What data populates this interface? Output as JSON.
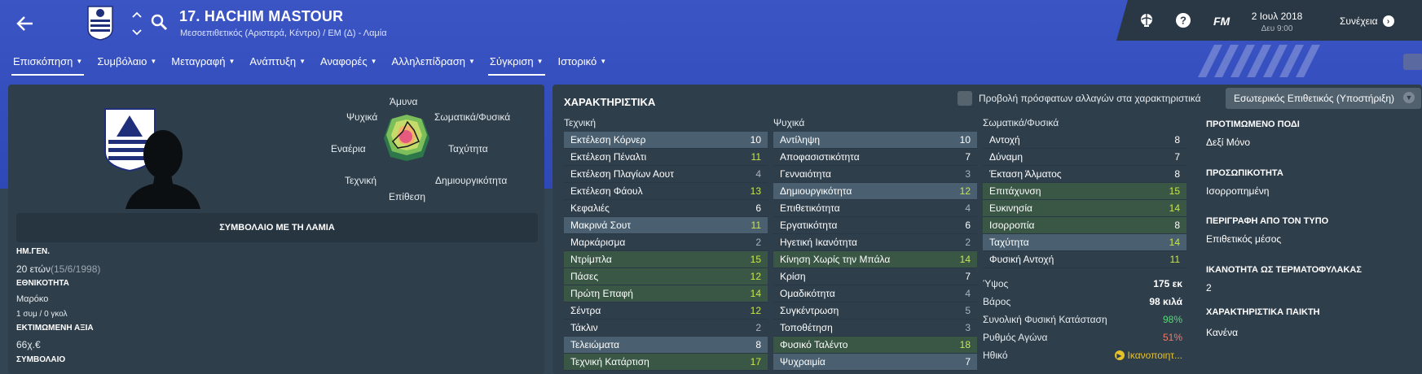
{
  "header": {
    "player_name": "17. HACHIM MASTOUR",
    "player_sub": "Μεσοεπιθετικός (Αριστερά, Κέντρο) / ΕΜ (Δ) - Λαμία"
  },
  "topbar": {
    "fm_label": "FM",
    "date": "2 Ιουλ 2018",
    "time": "Δευ 9:00",
    "continue_label": "Συνέχεια"
  },
  "nav": {
    "tabs": [
      "Επισκόπηση",
      "Συμβόλαιο",
      "Μεταγραφή",
      "Ανάπτυξη",
      "Αναφορές",
      "Αλληλεπίδραση",
      "Σύγκριση",
      "Ιστορικό"
    ]
  },
  "left": {
    "contract_bar": "ΣΥΜΒΟΛΑΙΟ ΜΕ ΤΗ ΛΑΜΙΑ",
    "dob_h": "ΗΜ.ΓΕΝ.",
    "dob_age": "20 ετών",
    "dob_date": "(15/6/1998)",
    "nat_h": "ΕΘΝΙΚΟΤΗΤΑ",
    "nat_v": "Μαρόκο",
    "caps": "1 συμ / 0 γκολ",
    "value_h": "ΕΚΤΙΜΩΜΕΝΗ ΑΞΙΑ",
    "value_v": "66χ.€",
    "contract_h": "ΣΥΜΒΟΛΑΙΟ"
  },
  "radar": {
    "labels": [
      "Άμυνα",
      "Σωματικά/Φυσικά",
      "Ταχύτητα",
      "Δημιουργικότητα",
      "Επίθεση",
      "Τεχνική",
      "Εναέρια",
      "Ψυχικά"
    ]
  },
  "attributes": {
    "title": "ΧΑΡΑΚΤΗΡΙΣΤΙΚΑ",
    "recent_changes": "Προβολή πρόσφατων αλλαγών στα χαρακτηριστικά",
    "role": "Εσωτερικός Επιθετικός (Υποστήριξη)",
    "technical_h": "Τεχνική",
    "mental_h": "Ψυχικά",
    "physical_h": "Σωματικά/Φυσικά",
    "technical": [
      {
        "name": "Εκτέλεση Κόρνερ",
        "value": "10",
        "style": "b",
        "vc": "w"
      },
      {
        "name": "Εκτέλεση Πέναλτι",
        "value": "11",
        "style": "n",
        "vc": "y"
      },
      {
        "name": "Εκτέλεση Πλαγίων Αουτ",
        "value": "4",
        "style": "n",
        "vc": ""
      },
      {
        "name": "Εκτέλεση Φάουλ",
        "value": "13",
        "style": "n",
        "vc": "y"
      },
      {
        "name": "Κεφαλιές",
        "value": "6",
        "style": "n",
        "vc": "w"
      },
      {
        "name": "Μακρινά Σουτ",
        "value": "11",
        "style": "b",
        "vc": "y"
      },
      {
        "name": "Μαρκάρισμα",
        "value": "2",
        "style": "n",
        "vc": ""
      },
      {
        "name": "Ντρίμπλα",
        "value": "15",
        "style": "g",
        "vc": "y"
      },
      {
        "name": "Πάσες",
        "value": "12",
        "style": "g",
        "vc": "y"
      },
      {
        "name": "Πρώτη Επαφή",
        "value": "14",
        "style": "g",
        "vc": "y"
      },
      {
        "name": "Σέντρα",
        "value": "12",
        "style": "n",
        "vc": "y"
      },
      {
        "name": "Τάκλιν",
        "value": "2",
        "style": "n",
        "vc": ""
      },
      {
        "name": "Τελειώματα",
        "value": "8",
        "style": "b",
        "vc": "w"
      },
      {
        "name": "Τεχνική Κατάρτιση",
        "value": "17",
        "style": "g",
        "vc": "y"
      }
    ],
    "mental": [
      {
        "name": "Αντίληψη",
        "value": "10",
        "style": "b",
        "vc": "w"
      },
      {
        "name": "Αποφασιστικότητα",
        "value": "7",
        "style": "n",
        "vc": "w"
      },
      {
        "name": "Γενναιότητα",
        "value": "3",
        "style": "n",
        "vc": ""
      },
      {
        "name": "Δημιουργικότητα",
        "value": "12",
        "style": "b",
        "vc": "y"
      },
      {
        "name": "Επιθετικότητα",
        "value": "4",
        "style": "n",
        "vc": ""
      },
      {
        "name": "Εργατικότητα",
        "value": "6",
        "style": "n",
        "vc": "w"
      },
      {
        "name": "Ηγετική Ικανότητα",
        "value": "2",
        "style": "n",
        "vc": ""
      },
      {
        "name": "Κίνηση Χωρίς την Μπάλα",
        "value": "14",
        "style": "g",
        "vc": "y"
      },
      {
        "name": "Κρίση",
        "value": "7",
        "style": "n",
        "vc": "w"
      },
      {
        "name": "Ομαδικότητα",
        "value": "4",
        "style": "n",
        "vc": ""
      },
      {
        "name": "Συγκέντρωση",
        "value": "5",
        "style": "n",
        "vc": ""
      },
      {
        "name": "Τοποθέτηση",
        "value": "3",
        "style": "n",
        "vc": ""
      },
      {
        "name": "Φυσικό Ταλέντο",
        "value": "18",
        "style": "g",
        "vc": "y"
      },
      {
        "name": "Ψυχραιμία",
        "value": "7",
        "style": "b",
        "vc": "w"
      }
    ],
    "physical": [
      {
        "name": "Αντοχή",
        "value": "8",
        "style": "n",
        "vc": "w"
      },
      {
        "name": "Δύναμη",
        "value": "7",
        "style": "n",
        "vc": "w"
      },
      {
        "name": "Έκταση Άλματος",
        "value": "8",
        "style": "n",
        "vc": "w"
      },
      {
        "name": "Επιτάχυνση",
        "value": "15",
        "style": "g",
        "vc": "y"
      },
      {
        "name": "Ευκινησία",
        "value": "14",
        "style": "g",
        "vc": "y"
      },
      {
        "name": "Ισορροπία",
        "value": "8",
        "style": "g",
        "vc": "w"
      },
      {
        "name": "Ταχύτητα",
        "value": "14",
        "style": "b",
        "vc": "y"
      },
      {
        "name": "Φυσική Αντοχή",
        "value": "11",
        "style": "n",
        "vc": "y"
      }
    ],
    "phys_info": [
      {
        "label": "Ύψος",
        "value": "175 εκ",
        "cls": ""
      },
      {
        "label": "Βάρος",
        "value": "98 κιλά",
        "cls": ""
      },
      {
        "label": "Συνολική Φυσική Κατάσταση",
        "value": "98%",
        "cls": "green"
      },
      {
        "label": "Ρυθμός Αγώνα",
        "value": "51%",
        "cls": "red"
      },
      {
        "label": "Ηθικό",
        "value": "Ικανοποιητ...",
        "cls": "pos"
      }
    ]
  },
  "right_info": {
    "foot_h": "ΠΡΟΤΙΜΩΜΕΝΟ ΠΟΔΙ",
    "foot_v": "Δεξί Μόνο",
    "pers_h": "ΠΡΟΣΩΠΙΚΟΤΗΤΑ",
    "pers_v": "Ισορροπημένη",
    "media_h": "ΠΕΡΙΓΡΑΦΗ ΑΠΟ ΤΟΝ ΤΥΠΟ",
    "media_v": "Επιθετικός μέσος",
    "gk_h": "ΙΚΑΝΟΤΗΤΑ ΩΣ ΤΕΡΜΑΤΟΦΥΛΑΚΑΣ",
    "gk_v": "2",
    "traits_h": "ΧΑΡΑΚΤΗΡΙΣΤΙΚΑ ΠΑΙΚΤΗ",
    "traits_v": "Κανένα"
  }
}
